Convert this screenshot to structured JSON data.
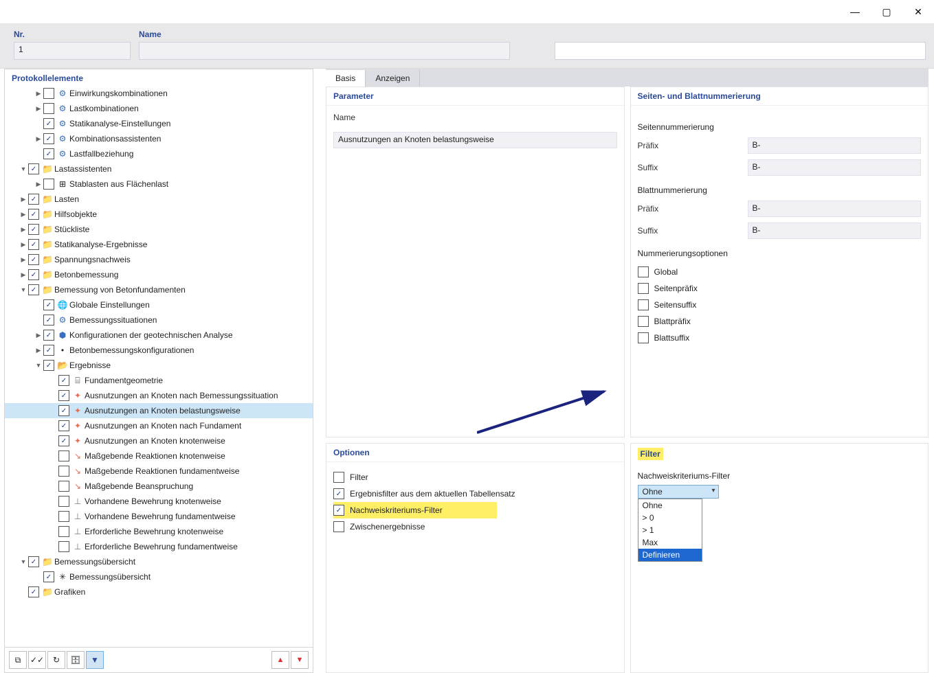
{
  "window": {
    "title": ""
  },
  "header": {
    "nr_label": "Nr.",
    "nr_value": "1",
    "name_label": "Name",
    "name_value": ""
  },
  "left": {
    "title": "Protokollelemente",
    "toolbar": {
      "expand": "⧉",
      "checkall": "✓✓",
      "refresh": "↻",
      "db": "🗄",
      "filter": "▼"
    },
    "nav_up": "▲",
    "nav_down": "▼"
  },
  "tree": [
    {
      "indent": 1,
      "exp": "▶",
      "checked": false,
      "icon": "⚙",
      "iconClass": "gearicon",
      "label": "Einwirkungskombinationen"
    },
    {
      "indent": 1,
      "exp": "▶",
      "checked": false,
      "icon": "⚙",
      "iconClass": "gearicon",
      "label": "Lastkombinationen"
    },
    {
      "indent": 1,
      "exp": "",
      "checked": true,
      "icon": "⚙",
      "iconClass": "gearicon",
      "label": "Statikanalyse-Einstellungen"
    },
    {
      "indent": 1,
      "exp": "▶",
      "checked": true,
      "icon": "⚙",
      "iconClass": "gearicon",
      "label": "Kombinationsassistenten"
    },
    {
      "indent": 1,
      "exp": "",
      "checked": true,
      "icon": "⚙",
      "iconClass": "gearicon",
      "label": "Lastfallbeziehung"
    },
    {
      "indent": 0,
      "exp": "▼",
      "checked": true,
      "icon": "📁",
      "iconClass": "folder",
      "label": "Lastassistenten"
    },
    {
      "indent": 1,
      "exp": "▶",
      "checked": false,
      "icon": "⊞",
      "iconClass": "",
      "label": "Stablasten aus Flächenlast"
    },
    {
      "indent": 0,
      "exp": "▶",
      "checked": true,
      "icon": "📁",
      "iconClass": "folder",
      "label": "Lasten"
    },
    {
      "indent": 0,
      "exp": "▶",
      "checked": true,
      "icon": "📁",
      "iconClass": "folder",
      "label": "Hilfsobjekte"
    },
    {
      "indent": 0,
      "exp": "▶",
      "checked": true,
      "icon": "📁",
      "iconClass": "folder",
      "label": "Stückliste"
    },
    {
      "indent": 0,
      "exp": "▶",
      "checked": true,
      "icon": "📁",
      "iconClass": "folder",
      "label": "Statikanalyse-Ergebnisse"
    },
    {
      "indent": 0,
      "exp": "▶",
      "checked": true,
      "icon": "📁",
      "iconClass": "folder",
      "label": "Spannungsnachweis"
    },
    {
      "indent": 0,
      "exp": "▶",
      "checked": true,
      "icon": "📁",
      "iconClass": "folder",
      "label": "Betonbemessung"
    },
    {
      "indent": 0,
      "exp": "▼",
      "checked": true,
      "icon": "📁",
      "iconClass": "folder",
      "label": "Bemessung von Betonfundamenten"
    },
    {
      "indent": 1,
      "exp": "",
      "checked": true,
      "icon": "🌐",
      "iconClass": "globe",
      "label": "Globale Einstellungen"
    },
    {
      "indent": 1,
      "exp": "",
      "checked": true,
      "icon": "⚙",
      "iconClass": "gearicon",
      "label": "Bemessungssituationen"
    },
    {
      "indent": 1,
      "exp": "▶",
      "checked": true,
      "icon": "⬢",
      "iconClass": "gearicon",
      "label": "Konfigurationen der geotechnischen Analyse"
    },
    {
      "indent": 1,
      "exp": "▶",
      "checked": true,
      "icon": "•",
      "iconClass": "",
      "label": "Betonbemessungskonfigurationen"
    },
    {
      "indent": 1,
      "exp": "▼",
      "checked": true,
      "icon": "📂",
      "iconClass": "folder",
      "label": "Ergebnisse"
    },
    {
      "indent": 2,
      "exp": "",
      "checked": true,
      "icon": "⌸",
      "iconClass": "",
      "label": "Fundamentgeometrie"
    },
    {
      "indent": 2,
      "exp": "",
      "checked": true,
      "icon": "✦",
      "iconClass": "colorful",
      "label": "Ausnutzungen an Knoten nach Bemessungssituation"
    },
    {
      "indent": 2,
      "exp": "",
      "checked": true,
      "icon": "✦",
      "iconClass": "colorful",
      "label": "Ausnutzungen an Knoten belastungsweise",
      "selected": true
    },
    {
      "indent": 2,
      "exp": "",
      "checked": true,
      "icon": "✦",
      "iconClass": "colorful",
      "label": "Ausnutzungen an Knoten nach Fundament"
    },
    {
      "indent": 2,
      "exp": "",
      "checked": true,
      "icon": "✦",
      "iconClass": "colorful",
      "label": "Ausnutzungen an Knoten knotenweise"
    },
    {
      "indent": 2,
      "exp": "",
      "checked": false,
      "icon": "↘",
      "iconClass": "colorful",
      "label": "Maßgebende Reaktionen knotenweise"
    },
    {
      "indent": 2,
      "exp": "",
      "checked": false,
      "icon": "↘",
      "iconClass": "colorful",
      "label": "Maßgebende Reaktionen fundamentweise"
    },
    {
      "indent": 2,
      "exp": "",
      "checked": false,
      "icon": "↘",
      "iconClass": "colorful",
      "label": "Maßgebende Beanspruchung"
    },
    {
      "indent": 2,
      "exp": "",
      "checked": false,
      "icon": "⊥",
      "iconClass": "rebar",
      "label": "Vorhandene Bewehrung knotenweise"
    },
    {
      "indent": 2,
      "exp": "",
      "checked": false,
      "icon": "⊥",
      "iconClass": "rebar",
      "label": "Vorhandene Bewehrung fundamentweise"
    },
    {
      "indent": 2,
      "exp": "",
      "checked": false,
      "icon": "⊥",
      "iconClass": "rebar",
      "label": "Erforderliche Bewehrung knotenweise"
    },
    {
      "indent": 2,
      "exp": "",
      "checked": false,
      "icon": "⊥",
      "iconClass": "rebar",
      "label": "Erforderliche Bewehrung fundamentweise"
    },
    {
      "indent": 0,
      "exp": "▼",
      "checked": true,
      "icon": "📁",
      "iconClass": "folder",
      "label": "Bemessungsübersicht"
    },
    {
      "indent": 1,
      "exp": "",
      "checked": true,
      "icon": "✳",
      "iconClass": "",
      "label": "Bemessungsübersicht"
    },
    {
      "indent": 0,
      "exp": "",
      "checked": true,
      "icon": "📁",
      "iconClass": "folder",
      "label": "Grafiken"
    }
  ],
  "tabs": {
    "basis": "Basis",
    "anzeigen": "Anzeigen"
  },
  "panel_param": {
    "title": "Parameter",
    "name_lbl": "Name",
    "name_val": "Ausnutzungen an Knoten belastungsweise"
  },
  "panel_numbering": {
    "title": "Seiten- und Blattnummerierung",
    "page_hdr": "Seitennummerierung",
    "sheet_hdr": "Blattnummerierung",
    "prefix_lbl": "Präfix",
    "suffix_lbl": "Suffix",
    "val": "B-",
    "opts_hdr": "Nummerierungsoptionen",
    "opt_global": "Global",
    "opt_seitenprefix": "Seitenpräfix",
    "opt_seitensuffix": "Seitensuffix",
    "opt_blattprefix": "Blattpräfix",
    "opt_blattsuffix": "Blattsuffix"
  },
  "panel_opts": {
    "title": "Optionen",
    "filter": "Filter",
    "erg": "Ergebnisfilter aus dem aktuellen Tabellensatz",
    "nach": "Nachweiskriteriums-Filter",
    "zw": "Zwischenergebnisse"
  },
  "panel_filter": {
    "title": "Filter",
    "lbl": "Nachweiskriteriums-Filter",
    "sel": "Ohne",
    "options": [
      "Ohne",
      "> 0",
      "> 1",
      "Max",
      "Definieren"
    ],
    "sel_idx": 4
  }
}
